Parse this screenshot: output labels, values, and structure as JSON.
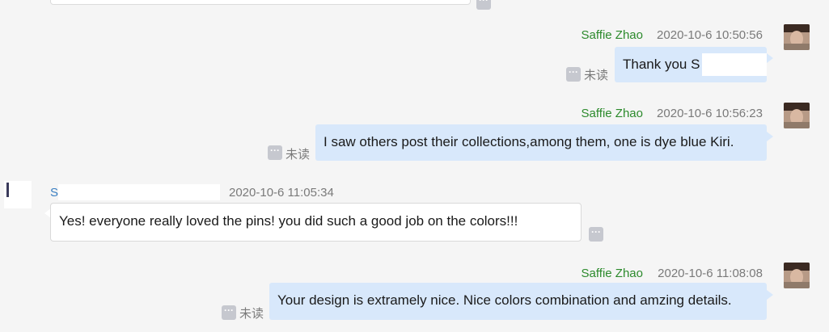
{
  "messages": [
    {
      "direction": "out",
      "sender": "Saffie Zhao",
      "timestamp": "2020-10-6 10:50:56",
      "text": "Thank you S",
      "status": "未读"
    },
    {
      "direction": "out",
      "sender": "Saffie Zhao",
      "timestamp": "2020-10-6 10:56:23",
      "text": "I saw others post their collections,among them, one is dye blue Kiri.",
      "status": "未读"
    },
    {
      "direction": "in",
      "sender": "S",
      "timestamp": "2020-10-6 11:05:34",
      "text": "Yes! everyone really loved the pins! you did such a good job on the colors!!!"
    },
    {
      "direction": "out",
      "sender": "Saffie Zhao",
      "timestamp": "2020-10-6 11:08:08",
      "text": "Your design is extramely nice. Nice colors combination and amzing details.",
      "status": "未读"
    }
  ],
  "icons": {
    "more": "more-options-icon",
    "avatar": "user-avatar"
  },
  "colors": {
    "background": "#f5f5f5",
    "outgoing_bubble": "#d8e8fb",
    "incoming_bubble": "#ffffff",
    "sender_name_self": "#2c8a2c",
    "sender_name_other": "#3a7fc2",
    "meta_text": "#7a7a7a"
  }
}
